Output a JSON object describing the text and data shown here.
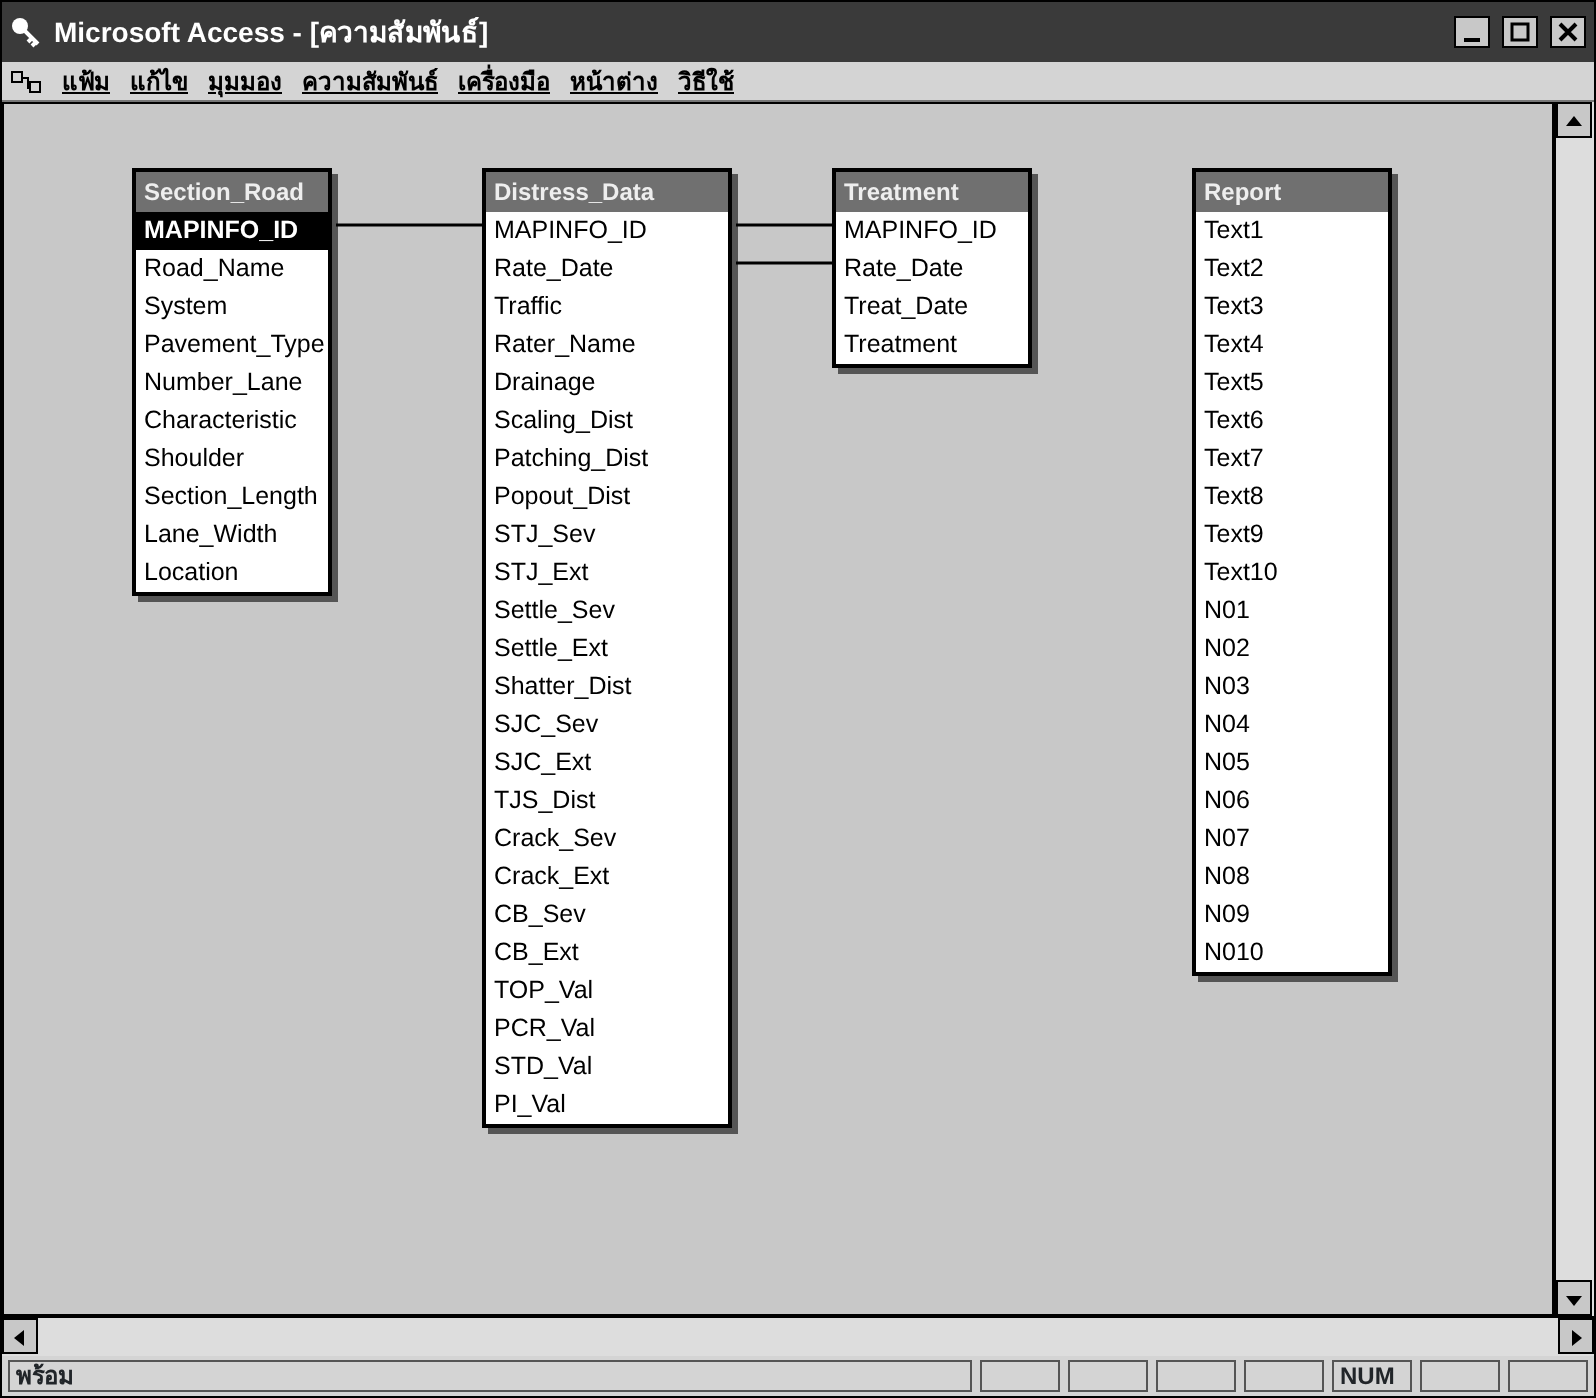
{
  "window": {
    "title": "Microsoft Access - [ความสัมพันธ์]"
  },
  "menu": [
    "แฟ้ม",
    "แก้ไข",
    "มุมมอง",
    "ความสัมพันธ์",
    "เครื่องมือ",
    "หน้าต่าง",
    "วิธีใช้"
  ],
  "tables": [
    {
      "title": "Section_Road",
      "fields": [
        {
          "name": "MAPINFO_ID",
          "selected": true
        },
        {
          "name": "Road_Name",
          "selected": false
        },
        {
          "name": "System",
          "selected": false
        },
        {
          "name": "Pavement_Type",
          "selected": false
        },
        {
          "name": "Number_Lane",
          "selected": false
        },
        {
          "name": "Characteristic",
          "selected": false
        },
        {
          "name": "Shoulder",
          "selected": false
        },
        {
          "name": "Section_Length",
          "selected": false
        },
        {
          "name": "Lane_Width",
          "selected": false
        },
        {
          "name": "Location",
          "selected": false
        }
      ]
    },
    {
      "title": "Distress_Data",
      "fields": [
        {
          "name": "MAPINFO_ID",
          "selected": false
        },
        {
          "name": "Rate_Date",
          "selected": false
        },
        {
          "name": "Traffic",
          "selected": false
        },
        {
          "name": "Rater_Name",
          "selected": false
        },
        {
          "name": "Drainage",
          "selected": false
        },
        {
          "name": "Scaling_Dist",
          "selected": false
        },
        {
          "name": "Patching_Dist",
          "selected": false
        },
        {
          "name": "Popout_Dist",
          "selected": false
        },
        {
          "name": "STJ_Sev",
          "selected": false
        },
        {
          "name": "STJ_Ext",
          "selected": false
        },
        {
          "name": "Settle_Sev",
          "selected": false
        },
        {
          "name": "Settle_Ext",
          "selected": false
        },
        {
          "name": "Shatter_Dist",
          "selected": false
        },
        {
          "name": "SJC_Sev",
          "selected": false
        },
        {
          "name": "SJC_Ext",
          "selected": false
        },
        {
          "name": "TJS_Dist",
          "selected": false
        },
        {
          "name": "Crack_Sev",
          "selected": false
        },
        {
          "name": "Crack_Ext",
          "selected": false
        },
        {
          "name": "CB_Sev",
          "selected": false
        },
        {
          "name": "CB_Ext",
          "selected": false
        },
        {
          "name": "TOP_Val",
          "selected": false
        },
        {
          "name": "PCR_Val",
          "selected": false
        },
        {
          "name": "STD_Val",
          "selected": false
        },
        {
          "name": "PI_Val",
          "selected": false
        }
      ]
    },
    {
      "title": "Treatment",
      "fields": [
        {
          "name": "MAPINFO_ID",
          "selected": false
        },
        {
          "name": "Rate_Date",
          "selected": false
        },
        {
          "name": "Treat_Date",
          "selected": false
        },
        {
          "name": "Treatment",
          "selected": false
        }
      ]
    },
    {
      "title": "Report",
      "fields": [
        {
          "name": "Text1",
          "selected": false
        },
        {
          "name": "Text2",
          "selected": false
        },
        {
          "name": "Text3",
          "selected": false
        },
        {
          "name": "Text4",
          "selected": false
        },
        {
          "name": "Text5",
          "selected": false
        },
        {
          "name": "Text6",
          "selected": false
        },
        {
          "name": "Text7",
          "selected": false
        },
        {
          "name": "Text8",
          "selected": false
        },
        {
          "name": "Text9",
          "selected": false
        },
        {
          "name": "Text10",
          "selected": false
        },
        {
          "name": "N01",
          "selected": false
        },
        {
          "name": "N02",
          "selected": false
        },
        {
          "name": "N03",
          "selected": false
        },
        {
          "name": "N04",
          "selected": false
        },
        {
          "name": "N05",
          "selected": false
        },
        {
          "name": "N06",
          "selected": false
        },
        {
          "name": "N07",
          "selected": false
        },
        {
          "name": "N08",
          "selected": false
        },
        {
          "name": "N09",
          "selected": false
        },
        {
          "name": "N010",
          "selected": false
        }
      ]
    }
  ],
  "status_bar": {
    "message": "พร้อม",
    "panels": [
      {
        "kind": "empty"
      },
      {
        "kind": "empty"
      },
      {
        "kind": "empty"
      },
      {
        "kind": "empty"
      },
      {
        "kind": "indicator",
        "text": "NUM"
      },
      {
        "kind": "empty"
      },
      {
        "kind": "empty"
      }
    ]
  }
}
